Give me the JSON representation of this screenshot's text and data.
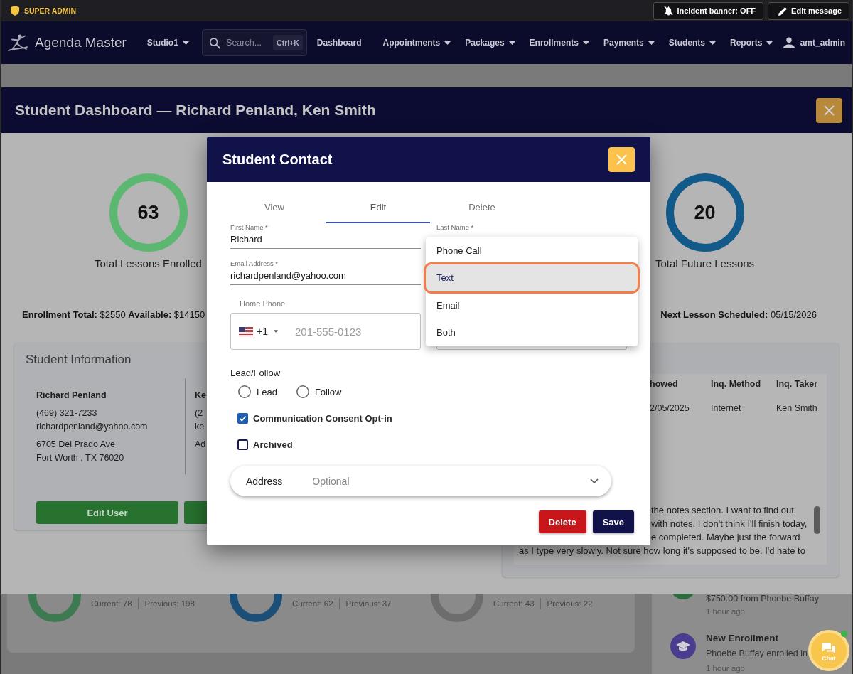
{
  "admin_bar": {
    "role": "SUPER ADMIN",
    "incident_button": {
      "label": "Incident banner: OFF"
    },
    "edit_message_button": {
      "label": "Edit message"
    }
  },
  "navbar": {
    "brand": "Agenda Master",
    "studio": {
      "label": "Studio1"
    },
    "search": {
      "placeholder": "Search...",
      "shortcut": "Ctrl+K"
    },
    "items": [
      {
        "label": "Dashboard",
        "has_menu": false
      },
      {
        "label": "Appointments",
        "has_menu": true
      },
      {
        "label": "Packages",
        "has_menu": true
      },
      {
        "label": "Enrollments",
        "has_menu": true
      },
      {
        "label": "Payments",
        "has_menu": true
      },
      {
        "label": "Students",
        "has_menu": true
      },
      {
        "label": "Reports",
        "has_menu": true
      }
    ],
    "user": "amt_admin"
  },
  "page": {
    "stats": [
      {
        "current": "Current: 78",
        "previous": "Previous: 198",
        "color": "#3d7a52"
      },
      {
        "current": "Current: 62",
        "previous": "Previous: 37",
        "color": "#1b4f78"
      },
      {
        "current": "Current: 43",
        "previous": "Previous: 22",
        "color": "#6d6d6d"
      }
    ],
    "activity": [
      {
        "kind": "payment",
        "color": "#2f6b40",
        "text": "$750.00 from Phoebe Buffay",
        "time": "1 hour ago"
      },
      {
        "kind": "enrollment",
        "color": "#4a3d8f",
        "title": "New Enrollment",
        "text": "Phoebe Buffay enrolled in",
        "time": "1 hour ago"
      }
    ]
  },
  "student_dashboard": {
    "title": "Student Dashboard — Richard Penland, Ken Smith",
    "stats": [
      {
        "value": "63",
        "label": "Total Lessons Enrolled",
        "color": "#5cb870"
      },
      {
        "value": "20",
        "label": "Total Future Lessons",
        "color": "#115a8a"
      }
    ],
    "enrollment_summary": "**Enrollment Total:** $2550 **Available:** $14150",
    "next_lesson": "**Next Lesson Scheduled:** 05/15/2026",
    "student_information": {
      "title": "Student Information",
      "contacts": [
        {
          "name": "Richard Penland",
          "phone": "(469) 321-7233",
          "email": "richardpenland@yahoo.com",
          "address": [
            "6705 Del Prado Ave",
            "Fort Worth , TX 76020"
          ]
        },
        {
          "name": "Ke",
          "phone": "(2",
          "email": "ke",
          "address": [
            "Ad"
          ]
        }
      ],
      "buttons": [
        {
          "label": "Edit User"
        }
      ]
    },
    "inquiries": {
      "columns": [
        "howed",
        "Inq. Method",
        "Inq. Taker"
      ],
      "rows": [
        [
          "2/05/2025",
          "Internet",
          "Ken Smith"
        ]
      ]
    },
    "notes": {
      "lines": [
        "the notes section. I want to find out",
        "with notes. I don't think I'll finish today,",
        "e completed. Maybe just the forward",
        "as I type very slowly. Not sure how long it's supposed to be. I'd hate to"
      ]
    }
  },
  "student_contact": {
    "title": "Student Contact",
    "tabs": [
      {
        "label": "View",
        "selected": false
      },
      {
        "label": "Edit",
        "selected": true
      },
      {
        "label": "Delete",
        "selected": false
      }
    ],
    "fields": {
      "first_name": {
        "label": "First Name *",
        "value": "Richard"
      },
      "last_name": {
        "label": "Last Name *"
      },
      "email": {
        "label": "Email Address *",
        "value": "richardpenland@yahoo.com"
      },
      "home_phone": {
        "label": "Home Phone",
        "country_code": "+1",
        "placeholder": "201-555-0123"
      }
    },
    "menu": {
      "options": [
        {
          "label": "Phone Call",
          "selected": false
        },
        {
          "label": "Text",
          "selected": true
        },
        {
          "label": "Email",
          "selected": false
        },
        {
          "label": "Both",
          "selected": false
        }
      ]
    },
    "lead_follow": {
      "label": "Lead/Follow",
      "options": [
        {
          "label": "Lead",
          "selected": false
        },
        {
          "label": "Follow",
          "selected": false
        }
      ]
    },
    "checkboxes": [
      {
        "label": "Communication Consent Opt-in",
        "checked": true
      },
      {
        "label": "Archived",
        "checked": false
      }
    ],
    "address": {
      "label": "Address",
      "note": "Optional",
      "expanded": false
    },
    "buttons": [
      {
        "label": "Delete",
        "kind": "danger"
      },
      {
        "label": "Save",
        "kind": "primary"
      }
    ]
  },
  "chat": {
    "label": "Chat",
    "online": true
  }
}
